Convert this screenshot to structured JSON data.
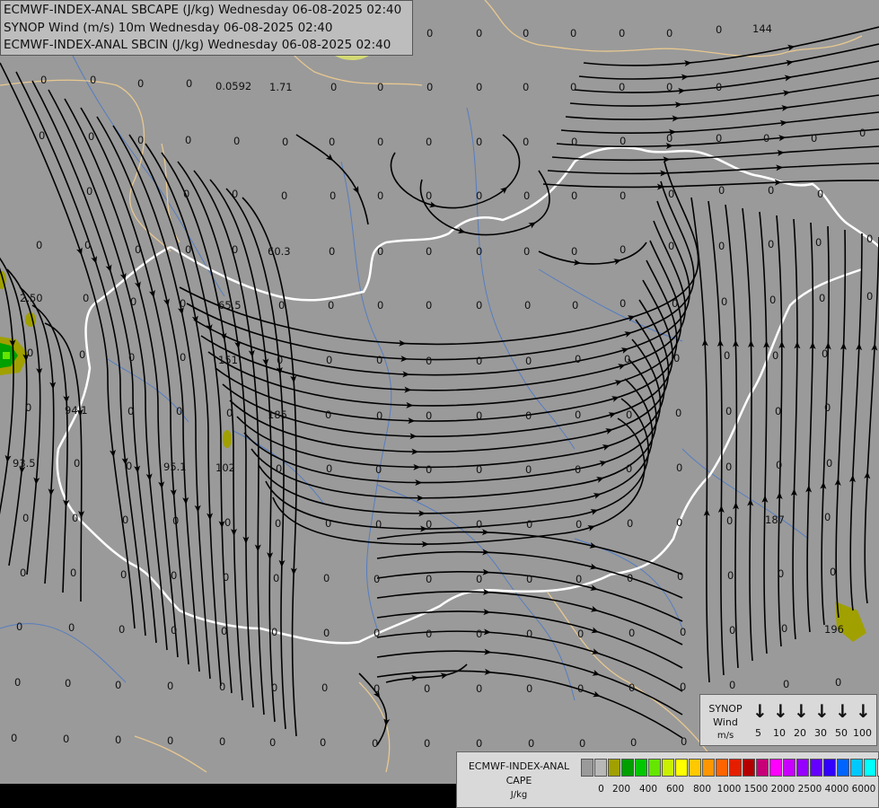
{
  "header": {
    "line1": "ECMWF-INDEX-ANAL SBCAPE (J/kg) Wednesday 06-08-2025 02:40",
    "line2": "SYNOP Wind (m/s) 10m Wednesday 06-08-2025 02:40",
    "line3": "ECMWF-INDEX-ANAL SBCIN (J/kg) Wednesday 06-08-2025 02:40"
  },
  "station_values": [
    "0",
    "0.0592",
    "1.71",
    "144",
    "60.3",
    "65.5",
    "151",
    "2.50",
    "94.1",
    "93.5",
    "95.1",
    "102",
    "185",
    "187",
    "196"
  ],
  "wind_legend": {
    "title_line1": "SYNOP",
    "title_line2": "Wind",
    "title_line3": "m/s",
    "speeds": [
      "5",
      "10",
      "20",
      "30",
      "50",
      "100"
    ]
  },
  "cape_legend": {
    "title_line1": "ECMWF-INDEX-ANAL",
    "title_line2": "CAPE",
    "title_line3": "J/kg",
    "tick_labels": [
      "0",
      "200",
      "400",
      "600",
      "800",
      "1000",
      "1500",
      "2000",
      "2500",
      "4000",
      "6000"
    ],
    "colors": [
      "#9a9a9a",
      "#b8b8b8",
      "#a0a000",
      "#00a000",
      "#00c800",
      "#64e600",
      "#c8f000",
      "#ffff00",
      "#ffc800",
      "#ff9600",
      "#ff6400",
      "#e61e00",
      "#b40000",
      "#c80078",
      "#ff00ff",
      "#c800ff",
      "#9600ff",
      "#6400ff",
      "#3200ff",
      "#0064ff",
      "#00c8ff",
      "#00ffff",
      "#ffffff"
    ]
  },
  "colors": {
    "background": "#9a9a9a",
    "border_national": "#ffffff",
    "border_regional": "#e8c890",
    "rivers": "#4a78c8",
    "streamlines": "#000000"
  }
}
